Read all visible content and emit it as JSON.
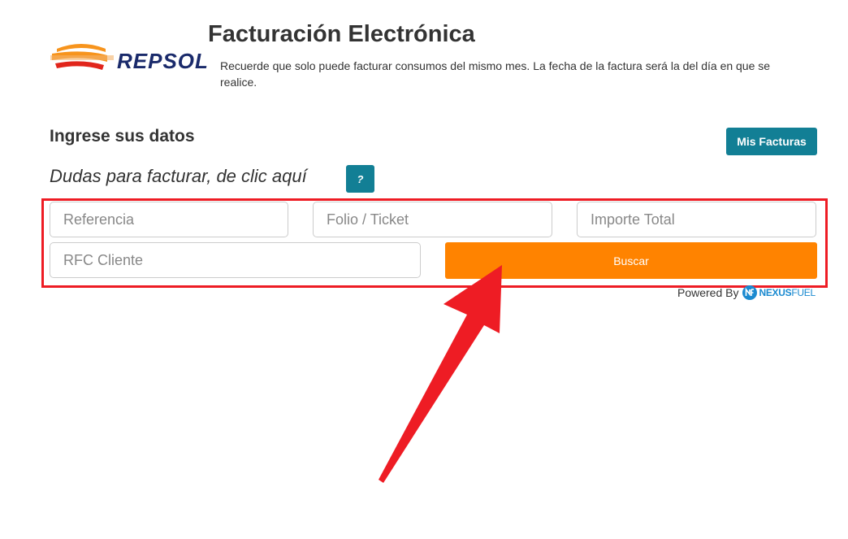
{
  "brand": {
    "name": "REPSOL",
    "colors": {
      "navy": "#1a2a6b",
      "orange": "#f7941d",
      "red": "#e1251b"
    }
  },
  "header": {
    "title": "Facturación Electrónica",
    "notice": "Recuerde que solo puede facturar consumos del mismo mes. La fecha de la factura será la del día en que se realice."
  },
  "section": {
    "title": "Ingrese sus datos",
    "help_text": "Dudas para facturar, de clic aquí",
    "help_button_label": "?",
    "mis_facturas_label": "Mis Facturas"
  },
  "form": {
    "referencia_placeholder": "Referencia",
    "folio_placeholder": "Folio / Ticket",
    "importe_placeholder": "Importe Total",
    "rfc_placeholder": "RFC Cliente",
    "buscar_label": "Buscar"
  },
  "footer": {
    "powered_label": "Powered By",
    "provider_name_a": "NEXUS",
    "provider_name_b": "FUEL"
  },
  "colors": {
    "teal_button": "#127f95",
    "orange_button": "#ff8300",
    "annotation_red": "#ee1c24",
    "provider_blue": "#1b8ad0"
  },
  "icons": {
    "logo": "repsol-logo-icon",
    "provider": "nexusfuel-logo-icon",
    "annotation": "red-arrow-icon"
  }
}
